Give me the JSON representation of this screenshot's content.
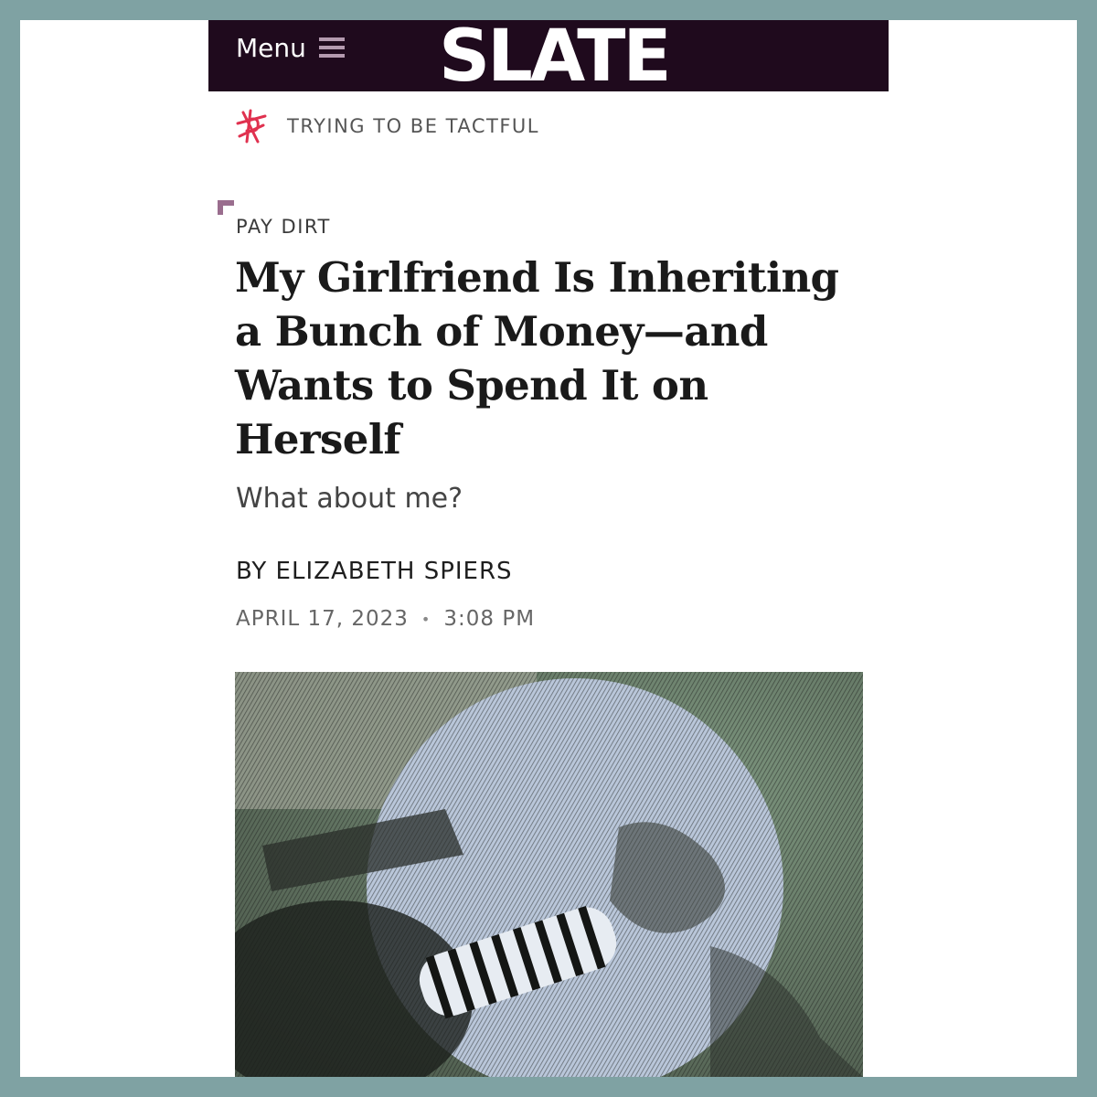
{
  "header": {
    "menu_label": "Menu",
    "logo_text": "SLATE"
  },
  "podcast": {
    "icon": "slate-squiggle-logo-icon",
    "label": "TRYING TO BE TACTFUL"
  },
  "article": {
    "kicker": "PAY DIRT",
    "headline": "My Girlfriend Is Inheriting a Bunch of Money—and Wants to Spend It on Herself",
    "dek": "What about me?",
    "byline": "BY ELIZABETH SPIERS",
    "date": "APRIL 17, 2023",
    "separator": "•",
    "time": "3:08 PM"
  },
  "colors": {
    "frame": "#7fa2a3",
    "topbar": "#1f0a1d",
    "accent": "#9a6d8e",
    "podcast_icon": "#e0314f"
  }
}
